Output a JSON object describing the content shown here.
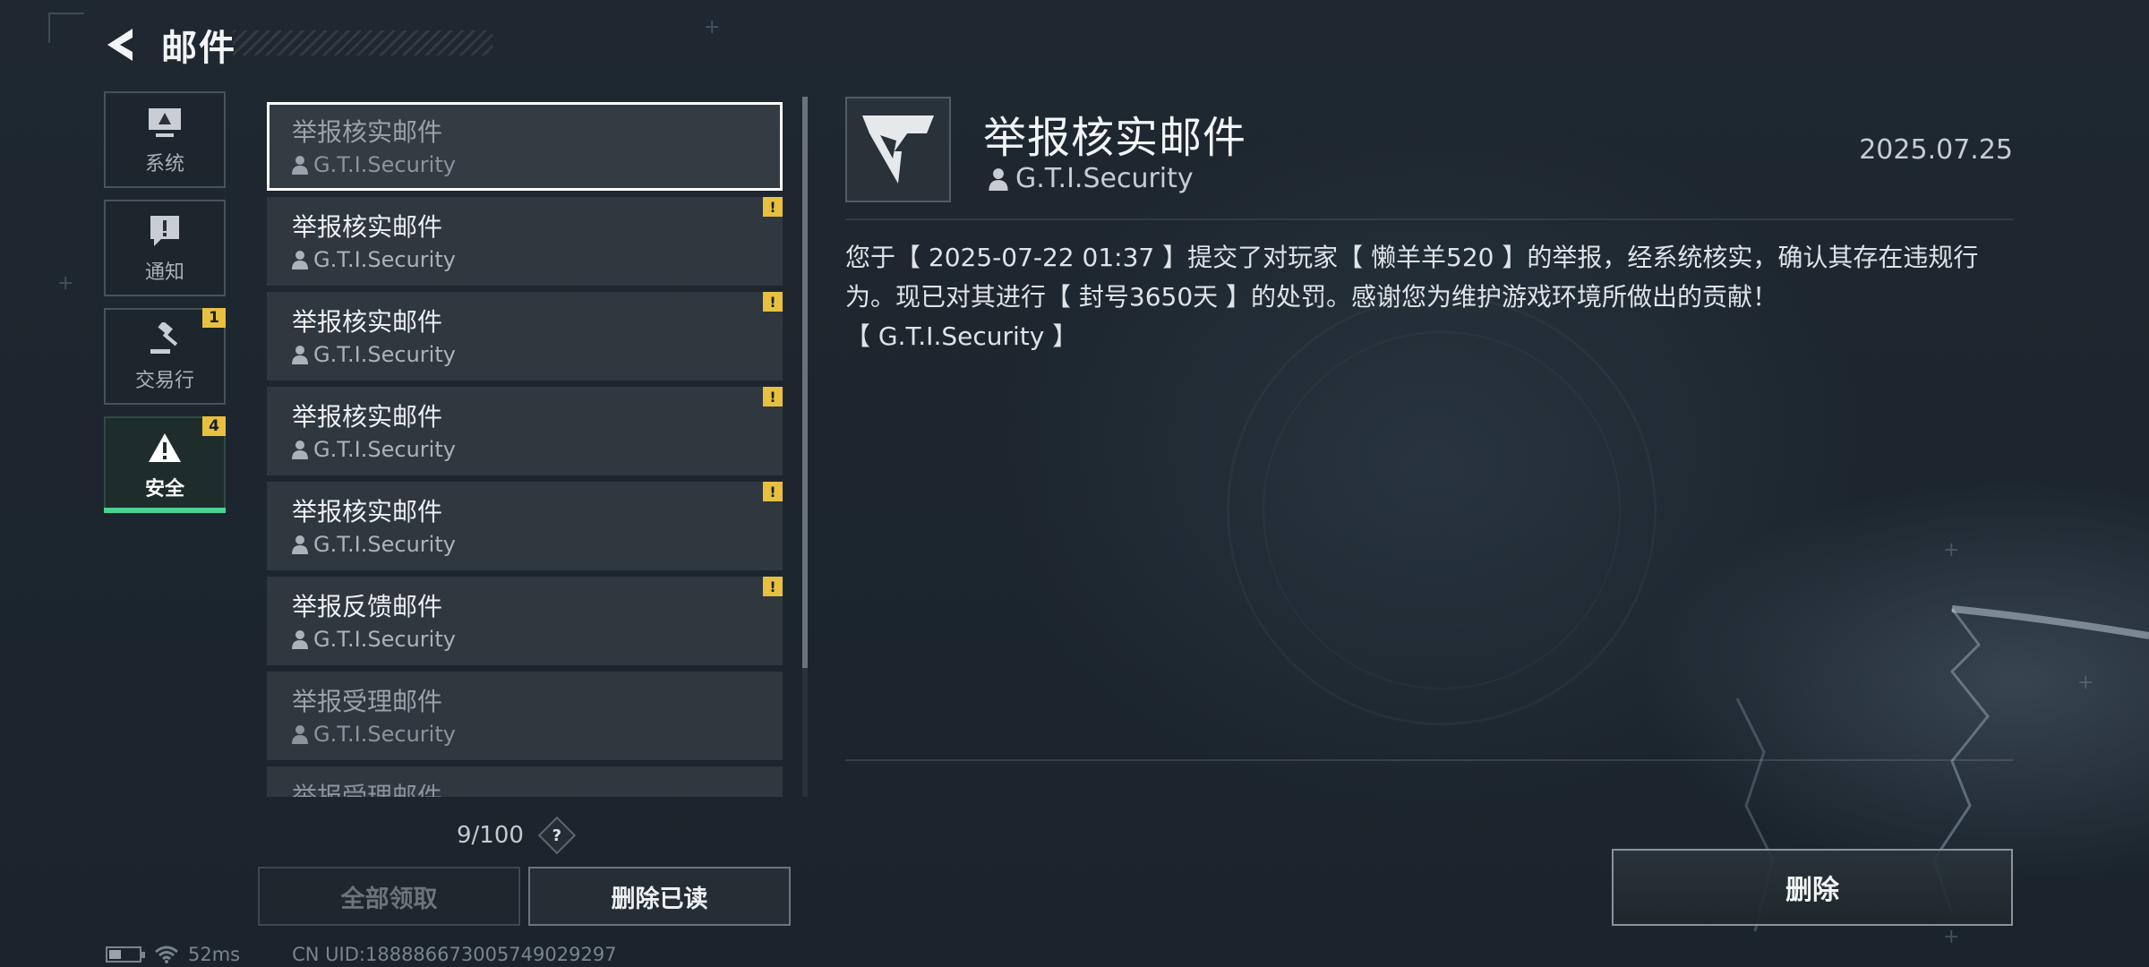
{
  "header": {
    "title": "邮件",
    "back_icon": "chevron-left-icon"
  },
  "sidebar": {
    "items": [
      {
        "label": "系统",
        "icon": "monitor-icon",
        "badge": ""
      },
      {
        "label": "通知",
        "icon": "exclamation-icon",
        "badge": ""
      },
      {
        "label": "交易行",
        "icon": "gavel-icon",
        "badge": "1"
      },
      {
        "label": "安全",
        "icon": "warning-triangle-icon",
        "badge": "4",
        "active": true
      }
    ]
  },
  "mail_list": {
    "items": [
      {
        "subject": "举报核实邮件",
        "sender": "G.T.I.Security",
        "selected": true,
        "read": true,
        "warning": false
      },
      {
        "subject": "举报核实邮件",
        "sender": "G.T.I.Security",
        "warning": true,
        "warning_mark": "!"
      },
      {
        "subject": "举报核实邮件",
        "sender": "G.T.I.Security",
        "warning": true,
        "warning_mark": "!"
      },
      {
        "subject": "举报核实邮件",
        "sender": "G.T.I.Security",
        "warning": true,
        "warning_mark": "!"
      },
      {
        "subject": "举报核实邮件",
        "sender": "G.T.I.Security",
        "warning": true,
        "warning_mark": "!"
      },
      {
        "subject": "举报反馈邮件",
        "sender": "G.T.I.Security",
        "warning": true,
        "warning_mark": "!"
      },
      {
        "subject": "举报受理邮件",
        "sender": "G.T.I.Security",
        "read": true,
        "warning": false
      },
      {
        "subject": "举报受理邮件",
        "sender": "",
        "read": true,
        "partial": true
      }
    ],
    "count": "9/100",
    "help_label": "?"
  },
  "actions": {
    "claim_all": "全部领取",
    "delete_read": "删除已读",
    "delete": "删除"
  },
  "status": {
    "ping": "52ms",
    "uid": "CN UID:18888667300574902929​7"
  },
  "detail": {
    "title": "举报核实邮件",
    "sender": "G.T.I.Security",
    "date": "2025.07.25",
    "body_line1": "您于【 2025-07-22 01:37 】提交了对玩家【 懒羊羊520 】的举报，经系统核实，确认其存在违规行",
    "body_line2": "为。现已对其进行【 封号3650天 】的处罚。感谢您为维护游戏环境所做出的贡献！",
    "body_line3": "【 G.T.I.Security 】"
  },
  "colors": {
    "accent_green": "#4bd291",
    "badge_yellow": "#e8c040"
  }
}
